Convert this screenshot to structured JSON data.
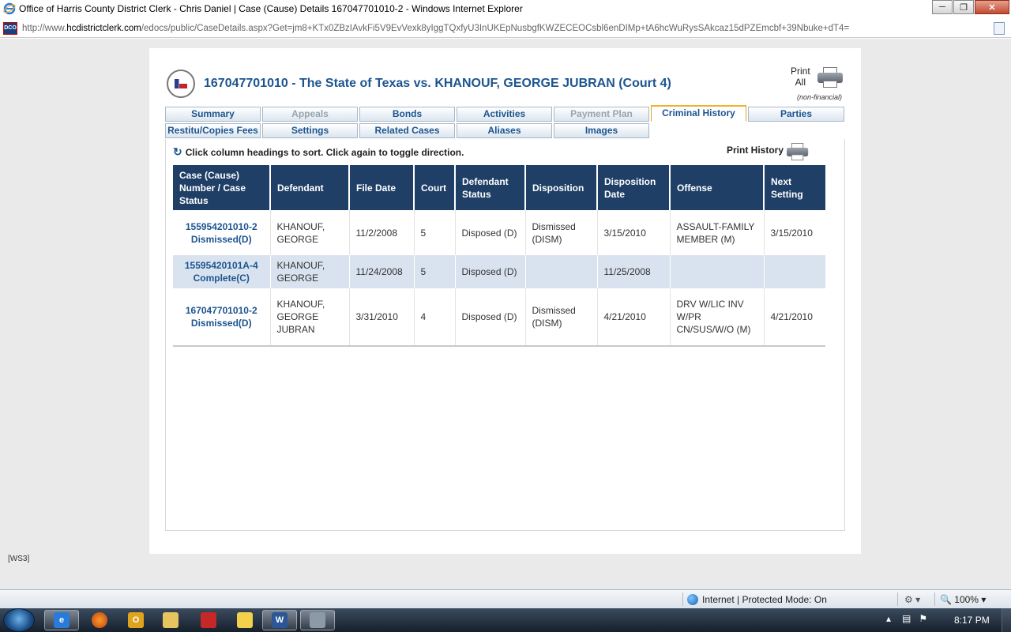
{
  "window": {
    "title": "Office of Harris County District Clerk - Chris Daniel | Case (Cause) Details 167047701010-2 - Windows Internet Explorer",
    "url_prefix": "http://www.",
    "url_domain": "hcdistrictclerk.com",
    "url_rest": "/edocs/public/CaseDetails.aspx?Get=jm8+KTx0ZBzIAvkFi5V9EvVexk8yIggTQxfyU3InUKEpNusbgfKWZECEOCsbl6enDIMp+tA6hcWuRysSAkcaz15dPZEmcbf+39Nbuke+dT4=",
    "dco_label": "DCO"
  },
  "header": {
    "case_title": "167047701010 - The State of Texas vs. KHANOUF, GEORGE JUBRAN (Court 4)",
    "print_all_line1": "Print",
    "print_all_line2": "All",
    "non_financial": "(non-financial)"
  },
  "tabs": {
    "row1": [
      {
        "label": "Summary",
        "state": "normal"
      },
      {
        "label": "Appeals",
        "state": "disabled"
      },
      {
        "label": "Bonds",
        "state": "normal"
      },
      {
        "label": "Activities",
        "state": "normal"
      },
      {
        "label": "Payment Plan",
        "state": "disabled"
      },
      {
        "label": "Criminal History",
        "state": "active"
      },
      {
        "label": "Parties",
        "state": "normal"
      }
    ],
    "row2": [
      {
        "label": "Restitu/Copies Fees",
        "state": "normal"
      },
      {
        "label": "Settings",
        "state": "normal"
      },
      {
        "label": "Related Cases",
        "state": "normal"
      },
      {
        "label": "Aliases",
        "state": "normal"
      },
      {
        "label": "Images",
        "state": "normal"
      }
    ]
  },
  "history": {
    "sort_hint": "Click column headings to sort. Click again to toggle direction.",
    "print_history": "Print History",
    "columns": [
      "Case (Cause) Number / Case Status",
      "Defendant",
      "File Date",
      "Court",
      "Defendant Status",
      "Disposition",
      "Disposition Date",
      "Offense",
      "Next Setting"
    ],
    "rows": [
      {
        "case_number": "155954201010-2",
        "case_status": "Dismissed(D)",
        "defendant": "KHANOUF, GEORGE",
        "file_date": "11/2/2008",
        "court": "5",
        "defendant_status": "Disposed (D)",
        "disposition": "Dismissed (DISM)",
        "disposition_date": "3/15/2010",
        "offense": "ASSAULT-FAMILY MEMBER (M)",
        "next_setting": "3/15/2010"
      },
      {
        "case_number": "15595420101A-4",
        "case_status": "Complete(C)",
        "defendant": "KHANOUF, GEORGE",
        "file_date": "11/24/2008",
        "court": "5",
        "defendant_status": "Disposed (D)",
        "disposition": "",
        "disposition_date": "11/25/2008",
        "offense": "",
        "next_setting": ""
      },
      {
        "case_number": "167047701010-2",
        "case_status": "Dismissed(D)",
        "defendant": "KHANOUF, GEORGE JUBRAN",
        "file_date": "3/31/2010",
        "court": "4",
        "defendant_status": "Disposed (D)",
        "disposition": "Dismissed (DISM)",
        "disposition_date": "4/21/2010",
        "offense": "DRV W/LIC INV W/PR CN/SUS/W/O (M)",
        "next_setting": "4/21/2010"
      }
    ]
  },
  "footer_tag": "[WS3]",
  "statusbar": {
    "zone": "Internet | Protected Mode: On",
    "zoom": "100%"
  },
  "taskbar": {
    "clock": "8:17 PM",
    "word_label": "W"
  }
}
